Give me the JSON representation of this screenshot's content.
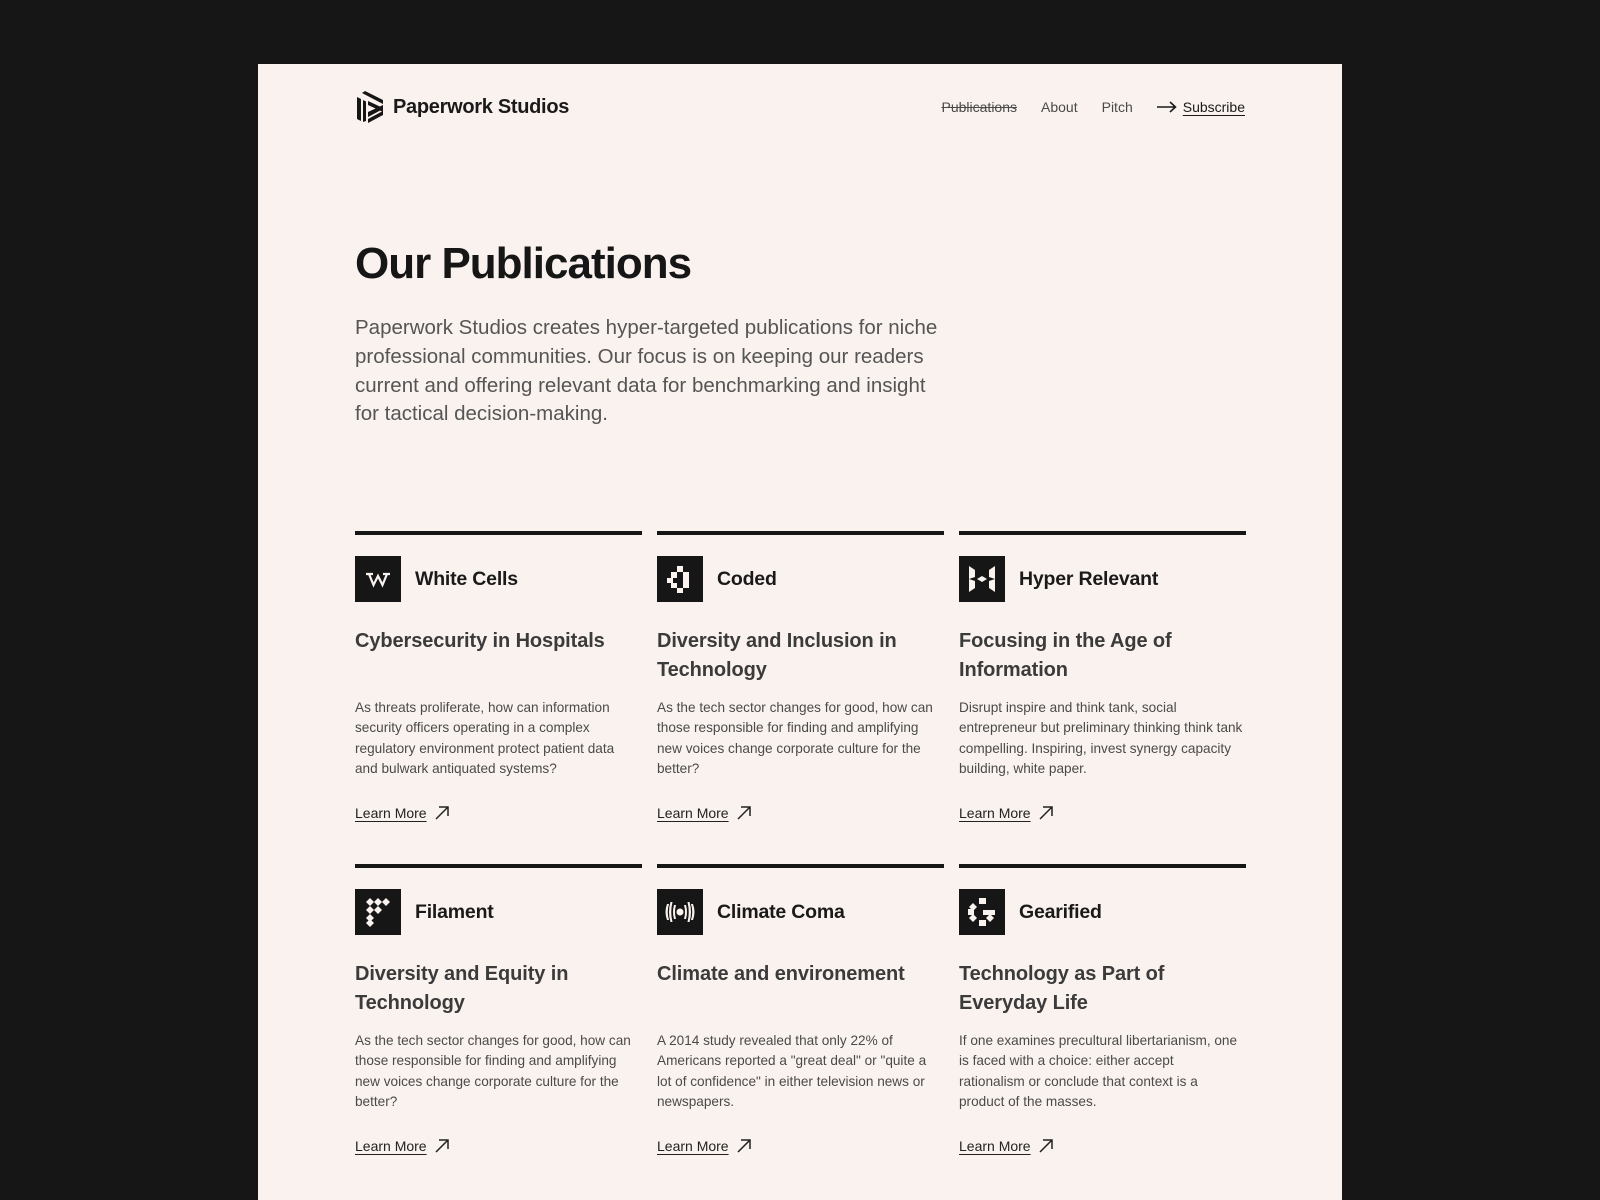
{
  "brand": {
    "name": "Paperwork Studios",
    "logo_icon": "paperwork-logo-icon"
  },
  "nav": {
    "items": [
      {
        "label": "Publications",
        "current": true
      },
      {
        "label": "About",
        "current": false
      },
      {
        "label": "Pitch",
        "current": false
      }
    ],
    "subscribe": {
      "label": "Subscribe",
      "icon": "arrow-right-icon"
    }
  },
  "hero": {
    "title": "Our Publications",
    "description": "Paperwork Studios creates hyper-targeted publications for niche professional communities. Our focus is on keeping our readers current and offering relevant data for benchmarking and insight for tactical decision-making."
  },
  "publications": [
    {
      "name": "White Cells",
      "icon": "white-cells-logo-icon",
      "title": "Cybersecurity in Hospitals",
      "description": "As threats proliferate, how can information security officers operating in a complex regulatory environment protect patient data and bulwark antiquated systems?",
      "link_label": "Learn More"
    },
    {
      "name": "Coded",
      "icon": "coded-logo-icon",
      "title": "Diversity and Inclusion in Technology",
      "description": "As the tech sector changes for good, how can those responsible for finding and amplifying new voices change corporate culture for the better?",
      "link_label": "Learn More"
    },
    {
      "name": "Hyper Relevant",
      "icon": "hyper-relevant-logo-icon",
      "title": "Focusing in the Age of Information",
      "description": "Disrupt inspire and think tank, social entrepreneur but preliminary thinking think tank compelling. Inspiring, invest synergy capacity building, white paper.",
      "link_label": "Learn More"
    },
    {
      "name": "Filament",
      "icon": "filament-logo-icon",
      "title": "Diversity and Equity in Technology",
      "description": "As the tech sector changes for good, how can those responsible for finding and amplifying new voices change corporate culture for the better?",
      "link_label": "Learn More"
    },
    {
      "name": "Climate Coma",
      "icon": "climate-coma-logo-icon",
      "title": "Climate and environement",
      "description": "A 2014 study revealed that only 22% of Americans reported a \"great deal\" or \"quite a lot of confidence\" in either television news or newspapers.",
      "link_label": "Learn More"
    },
    {
      "name": "Gearified",
      "icon": "gearified-logo-icon",
      "title": "Technology as Part of Everyday Life",
      "description": "If one examines precultural libertarianism, one is faced with a choice: either accept rationalism or conclude that context is a product of the masses.",
      "link_label": "Learn More"
    }
  ],
  "colors": {
    "page_background": "#faf2ee",
    "outer_background": "#161616",
    "ink": "#161616",
    "body_text": "#4a4a4a"
  }
}
